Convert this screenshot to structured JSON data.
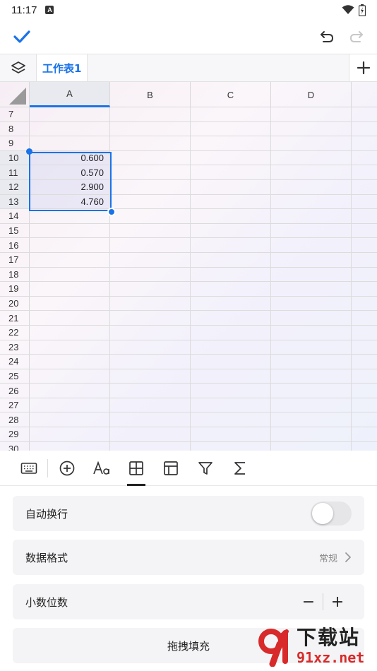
{
  "status": {
    "time": "11:17",
    "a_icon_label": "A"
  },
  "toolbar": {
    "confirm_icon": "check-icon",
    "undo_icon": "undo-icon",
    "redo_icon": "redo-icon"
  },
  "sheet": {
    "active_tab": "工作表1",
    "add_icon": "plus-icon"
  },
  "grid": {
    "columns": [
      "A",
      "B",
      "C",
      "D"
    ],
    "rows": [
      {
        "num": "7",
        "cells": [
          "",
          "",
          "",
          ""
        ]
      },
      {
        "num": "8",
        "cells": [
          "",
          "",
          "",
          ""
        ]
      },
      {
        "num": "9",
        "cells": [
          "",
          "",
          "",
          ""
        ]
      },
      {
        "num": "10",
        "cells": [
          "0.600",
          "",
          "",
          ""
        ]
      },
      {
        "num": "11",
        "cells": [
          "0.570",
          "",
          "",
          ""
        ]
      },
      {
        "num": "12",
        "cells": [
          "2.900",
          "",
          "",
          ""
        ]
      },
      {
        "num": "13",
        "cells": [
          "4.760",
          "",
          "",
          ""
        ]
      },
      {
        "num": "14",
        "cells": [
          "",
          "",
          "",
          ""
        ]
      },
      {
        "num": "15",
        "cells": [
          "",
          "",
          "",
          ""
        ]
      },
      {
        "num": "16",
        "cells": [
          "",
          "",
          "",
          ""
        ]
      },
      {
        "num": "17",
        "cells": [
          "",
          "",
          "",
          ""
        ]
      },
      {
        "num": "18",
        "cells": [
          "",
          "",
          "",
          ""
        ]
      },
      {
        "num": "19",
        "cells": [
          "",
          "",
          "",
          ""
        ]
      },
      {
        "num": "20",
        "cells": [
          "",
          "",
          "",
          ""
        ]
      },
      {
        "num": "21",
        "cells": [
          "",
          "",
          "",
          ""
        ]
      },
      {
        "num": "22",
        "cells": [
          "",
          "",
          "",
          ""
        ]
      },
      {
        "num": "23",
        "cells": [
          "",
          "",
          "",
          ""
        ]
      },
      {
        "num": "24",
        "cells": [
          "",
          "",
          "",
          ""
        ]
      },
      {
        "num": "25",
        "cells": [
          "",
          "",
          "",
          ""
        ]
      },
      {
        "num": "26",
        "cells": [
          "",
          "",
          "",
          ""
        ]
      },
      {
        "num": "27",
        "cells": [
          "",
          "",
          "",
          ""
        ]
      },
      {
        "num": "28",
        "cells": [
          "",
          "",
          "",
          ""
        ]
      },
      {
        "num": "29",
        "cells": [
          "",
          "",
          "",
          ""
        ]
      },
      {
        "num": "30",
        "cells": [
          "",
          "",
          "",
          ""
        ]
      }
    ],
    "selected_column": "A",
    "selected_rows": [
      "10",
      "11",
      "12",
      "13"
    ]
  },
  "format_toolbar": {
    "items": [
      "keyboard-icon",
      "insert-icon",
      "font-icon",
      "cell-format-icon",
      "table-icon",
      "filter-icon",
      "sum-icon"
    ],
    "active": "cell-format-icon"
  },
  "panel": {
    "wrap_label": "自动换行",
    "wrap_enabled": false,
    "format_label": "数据格式",
    "format_value": "常规",
    "decimal_label": "小数位数",
    "decimal_minus": "−",
    "decimal_plus": "+",
    "fill_label": "拖拽填充"
  },
  "watermark": {
    "title": "下载站",
    "url": "91xz.net"
  },
  "colors": {
    "accent": "#1a73e8",
    "watermark_red": "#d82a2a"
  }
}
